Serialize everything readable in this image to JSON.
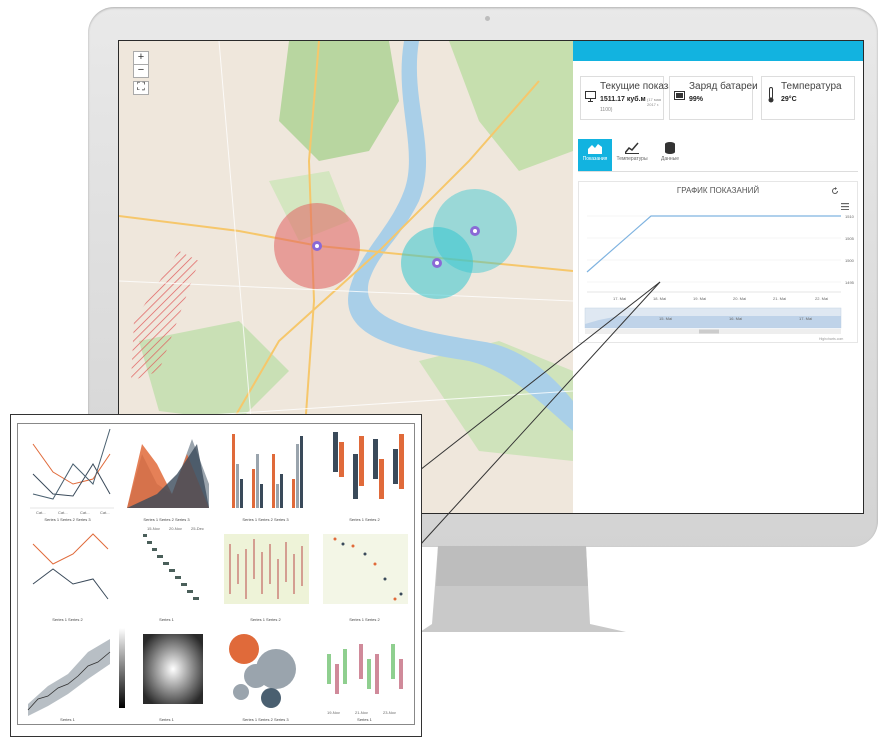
{
  "map": {
    "zoom_in": "+",
    "zoom_out": "−",
    "fullscreen": "⛶"
  },
  "panel": {
    "cards": [
      {
        "label": "Текущие показания",
        "value": "1511.17 куб.м",
        "value_note": "(17 мая 2017 г.",
        "sub": "1100)"
      },
      {
        "label": "Заряд батареи",
        "value": "99%"
      },
      {
        "label": "Температура",
        "value": "29°C"
      }
    ],
    "tabs": [
      "Показания",
      "Температуры",
      "Данные"
    ],
    "chart_title": "ГРАФИК ПОКАЗАНИЙ",
    "chart_y_ticks": [
      "1510",
      "1505",
      "1500",
      "1495"
    ],
    "chart_x_ticks": [
      "17. Mai",
      "18. Mai",
      "19. Mai",
      "20. Mai",
      "21. Mai",
      "22. Mai"
    ],
    "navigator_ticks": [
      "15. Mai",
      "16. Mai",
      "17. Mai"
    ],
    "credit": "Highcharts.com"
  },
  "callout_legends": {
    "c1": "Series 1  Series 2  Series 3",
    "c2": "Series 1  Series 2  Series 3",
    "c3": "Series 1  Series 2  Series 3",
    "c4": "Series 1  Series 2",
    "c5": "Series 1  Series 2",
    "c6": "Series 1",
    "c7": "Series 1  Series 2",
    "c8": "Series 1  Series 2",
    "c9": "Series 1",
    "c10": "Series 1",
    "c11": "Series 1  Series 2  Series 3",
    "c12": "Series 1"
  },
  "callout_labels": {
    "gantt_header": [
      "15-Nov",
      "20-Nov",
      "25-Dec"
    ],
    "gantt_tasks": [
      "Task 10",
      "Task 9",
      "Task 8",
      "Task 7",
      "Task 6",
      "Task 5",
      "Task 4",
      "Task 3",
      "Task 2",
      "Task 1"
    ],
    "candle_x": [
      "19-Nov",
      "21-Nov",
      "23-Nov"
    ],
    "cats": [
      "Cat...",
      "Cat...",
      "Cat...",
      "Cat..."
    ]
  }
}
